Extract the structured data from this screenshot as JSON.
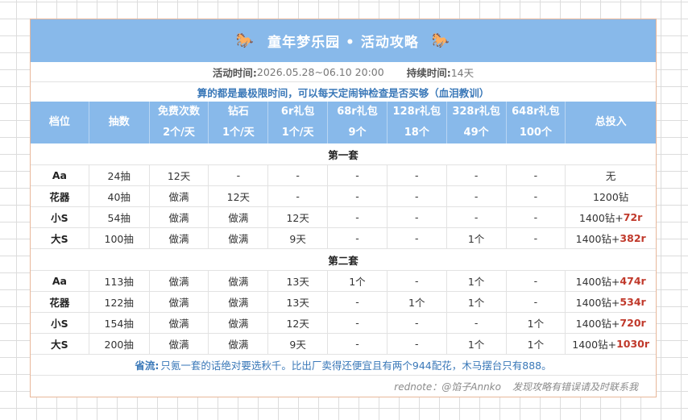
{
  "title": {
    "icon": "🐎",
    "text": "童年梦乐园 • 活动攻略"
  },
  "info": {
    "time_label": "活动时间:",
    "time_value": "2026.05.28~06.10 20:00",
    "duration_label": "持续时间:",
    "duration_value": "14天"
  },
  "warning": "算的都是最极限时间，可以每天定闹钟检查是否买够（血泪教训）",
  "headers": [
    {
      "top": "档位",
      "bottom": ""
    },
    {
      "top": "抽数",
      "bottom": ""
    },
    {
      "top": "免费次数",
      "bottom": "2个/天"
    },
    {
      "top": "钻石",
      "bottom": "1个/天"
    },
    {
      "top": "6r礼包",
      "bottom": "1个/天"
    },
    {
      "top": "68r礼包",
      "bottom": "9个"
    },
    {
      "top": "128r礼包",
      "bottom": "18个"
    },
    {
      "top": "328r礼包",
      "bottom": "49个"
    },
    {
      "top": "648r礼包",
      "bottom": "100个"
    },
    {
      "top": "总投入",
      "bottom": ""
    }
  ],
  "sections": [
    {
      "title": "第一套",
      "rows": [
        {
          "cells": [
            "Aa",
            "24抽",
            "12天",
            "-",
            "-",
            "-",
            "-",
            "-",
            "-"
          ],
          "total": "无",
          "extra": ""
        },
        {
          "cells": [
            "花器",
            "40抽",
            "做满",
            "12天",
            "-",
            "-",
            "-",
            "-",
            "-"
          ],
          "total": "1200钻",
          "extra": ""
        },
        {
          "cells": [
            "小S",
            "54抽",
            "做满",
            "做满",
            "12天",
            "-",
            "-",
            "-",
            "-"
          ],
          "total": "1400钻+",
          "extra": "72r"
        },
        {
          "cells": [
            "大S",
            "100抽",
            "做满",
            "做满",
            "9天",
            "-",
            "-",
            "1个",
            "-"
          ],
          "total": "1400钻+",
          "extra": "382r"
        }
      ]
    },
    {
      "title": "第二套",
      "rows": [
        {
          "cells": [
            "Aa",
            "113抽",
            "做满",
            "做满",
            "13天",
            "1个",
            "-",
            "1个",
            "-"
          ],
          "total": "1400钻+",
          "extra": "474r"
        },
        {
          "cells": [
            "花器",
            "122抽",
            "做满",
            "做满",
            "13天",
            "-",
            "1个",
            "1个",
            "-"
          ],
          "total": "1400钻+",
          "extra": "534r"
        },
        {
          "cells": [
            "小S",
            "154抽",
            "做满",
            "做满",
            "12天",
            "-",
            "-",
            "-",
            "1个"
          ],
          "total": "1400钻+",
          "extra": "720r"
        },
        {
          "cells": [
            "大S",
            "200抽",
            "做满",
            "做满",
            "9天",
            "-",
            "-",
            "1个",
            "1个"
          ],
          "total": "1400钻+",
          "extra": "1030r"
        }
      ]
    }
  ],
  "note": {
    "label": "省流:",
    "text": "只氪一套的话绝对要选秋千。比出厂卖得还便宜且有两个944配花，木马摆台只有888。"
  },
  "credit": {
    "source": "rednote：@馅子Annko",
    "text": "发现攻略有错误请及时联系我"
  }
}
